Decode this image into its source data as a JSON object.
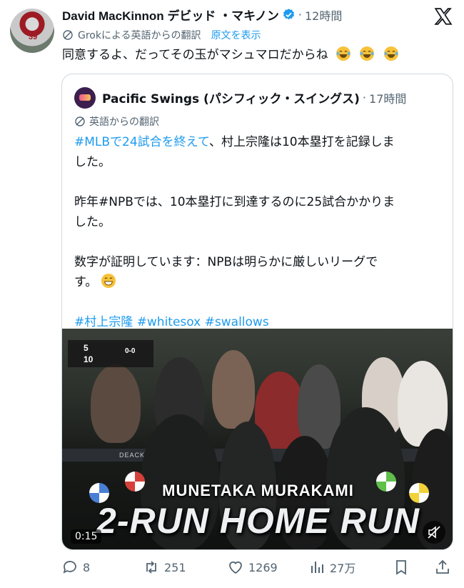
{
  "post": {
    "author_name": "David MacKinnon デビッド ・マキノン",
    "separator": "·",
    "time": "12時間",
    "translation_note": "Grokによる英語からの翻訳",
    "show_original": "原文を表示",
    "text": "同意するよ、だってその玉がマシュマロだからね",
    "avatar_number": "39",
    "verified_icon": "verified-badge-icon",
    "brand_icon": "x-logo-icon"
  },
  "quote": {
    "author_name": "Pacific Swings (パシフィック・スイングス)",
    "separator": "·",
    "time": "17時間",
    "translation_note": "英語からの翻訳",
    "line1_hashtag": "#MLBで24試合を終えて",
    "line1_rest": "、村上宗隆は10本塁打を記録しま",
    "line2": "した。",
    "line3": "昨年#NPBでは、10本塁打に到達するのに25試合かかりま",
    "line4": "した。",
    "line5": "数字が証明しています：NPBは明らかに厳しいリーグで",
    "line6": "す。",
    "hashtags": [
      "#村上宗隆",
      "#whitesox",
      "#swallows"
    ]
  },
  "media": {
    "score_sox": "5",
    "score_dbacks": "10",
    "count": "0-0",
    "ad_text": "DEACKS.COM      SEATGEEK",
    "banner_name": "MUNETAKA MURAKAMI",
    "banner_title": "2-RUN HOME RUN",
    "duration": "0:15",
    "mute_icon": "muted-speaker-icon"
  },
  "actions": {
    "replies": "8",
    "reposts": "251",
    "likes": "1269",
    "views": "27万"
  },
  "colors": {
    "link": "#1d9bf0",
    "muted": "#536471",
    "text": "#0f1419",
    "border": "#cfd9de"
  }
}
